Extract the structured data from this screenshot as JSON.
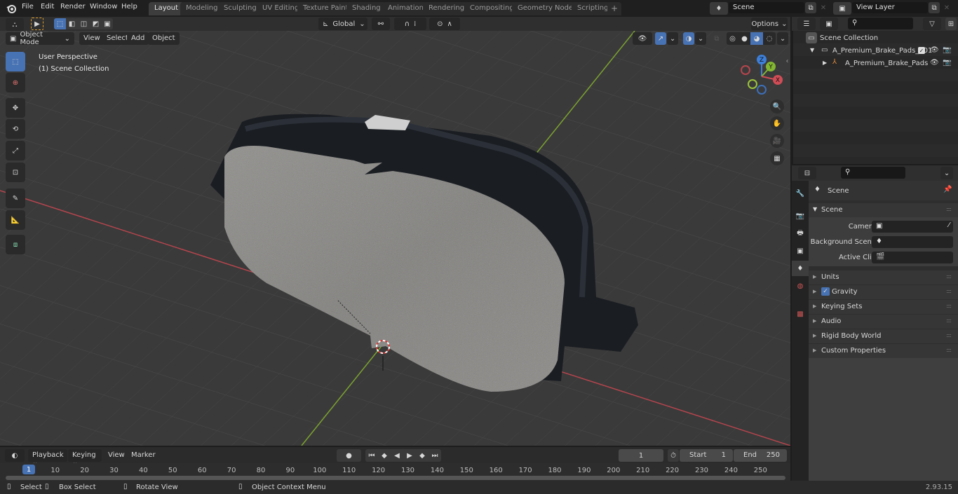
{
  "app": {
    "version": "2.93.15"
  },
  "menu": [
    "File",
    "Edit",
    "Render",
    "Window",
    "Help"
  ],
  "workspaces": [
    {
      "label": "Layout",
      "active": true
    },
    {
      "label": "Modeling"
    },
    {
      "label": "Sculpting"
    },
    {
      "label": "UV Editing"
    },
    {
      "label": "Texture Paint"
    },
    {
      "label": "Shading"
    },
    {
      "label": "Animation"
    },
    {
      "label": "Rendering"
    },
    {
      "label": "Compositing"
    },
    {
      "label": "Geometry Nodes"
    },
    {
      "label": "Scripting"
    }
  ],
  "add_workspace": "+",
  "scene_selector": {
    "value": "Scene"
  },
  "view_layer_selector": {
    "value": "View Layer"
  },
  "viewport": {
    "mode": "Object Mode",
    "menus": [
      "View",
      "Select",
      "Add",
      "Object"
    ],
    "orientation": "Global",
    "options_label": "Options",
    "overlay_text": [
      "User Perspective",
      "(1) Scene Collection"
    ],
    "gizmo_axes": {
      "x": "X",
      "y": "Y",
      "z": "Z"
    },
    "object_name": "A_Premium_Brake_Pads",
    "colors": {
      "x_axis": "#d04d56",
      "y_axis": "#83b632",
      "z_axis": "#3d7fd9",
      "active_tool": "#4772b3"
    }
  },
  "tools": [
    "select-box",
    "cursor",
    "move",
    "rotate",
    "scale",
    "transform",
    "annotate",
    "measure",
    "add-cube"
  ],
  "outliner": {
    "root": "Scene Collection",
    "items": [
      {
        "label": "A_Premium_Brake_Pads_001",
        "type": "collection",
        "checked": true
      },
      {
        "label": "A_Premium_Brake_Pads",
        "type": "armature"
      }
    ]
  },
  "properties": {
    "context": "Scene",
    "panel_title": "Scene",
    "fields": [
      {
        "label": "Camera",
        "value": ""
      },
      {
        "label": "Background Scene",
        "value": ""
      },
      {
        "label": "Active Clip",
        "value": ""
      }
    ],
    "sections": [
      {
        "label": "Units"
      },
      {
        "label": "Gravity",
        "checkbox": true
      },
      {
        "label": "Keying Sets"
      },
      {
        "label": "Audio"
      },
      {
        "label": "Rigid Body World"
      },
      {
        "label": "Custom Properties"
      }
    ]
  },
  "timeline": {
    "menus": [
      "Playback",
      "Keying",
      "View",
      "Marker"
    ],
    "current_frame": "1",
    "start_label": "Start",
    "start": "1",
    "end_label": "End",
    "end": "250",
    "ticks": [
      "1",
      "10",
      "20",
      "30",
      "40",
      "50",
      "60",
      "70",
      "80",
      "90",
      "100",
      "110",
      "120",
      "130",
      "140",
      "150",
      "160",
      "170",
      "180",
      "190",
      "200",
      "210",
      "220",
      "230",
      "240",
      "250"
    ]
  },
  "statusbar": {
    "items": [
      "Select",
      "Box Select",
      "Rotate View",
      "Object Context Menu"
    ]
  }
}
